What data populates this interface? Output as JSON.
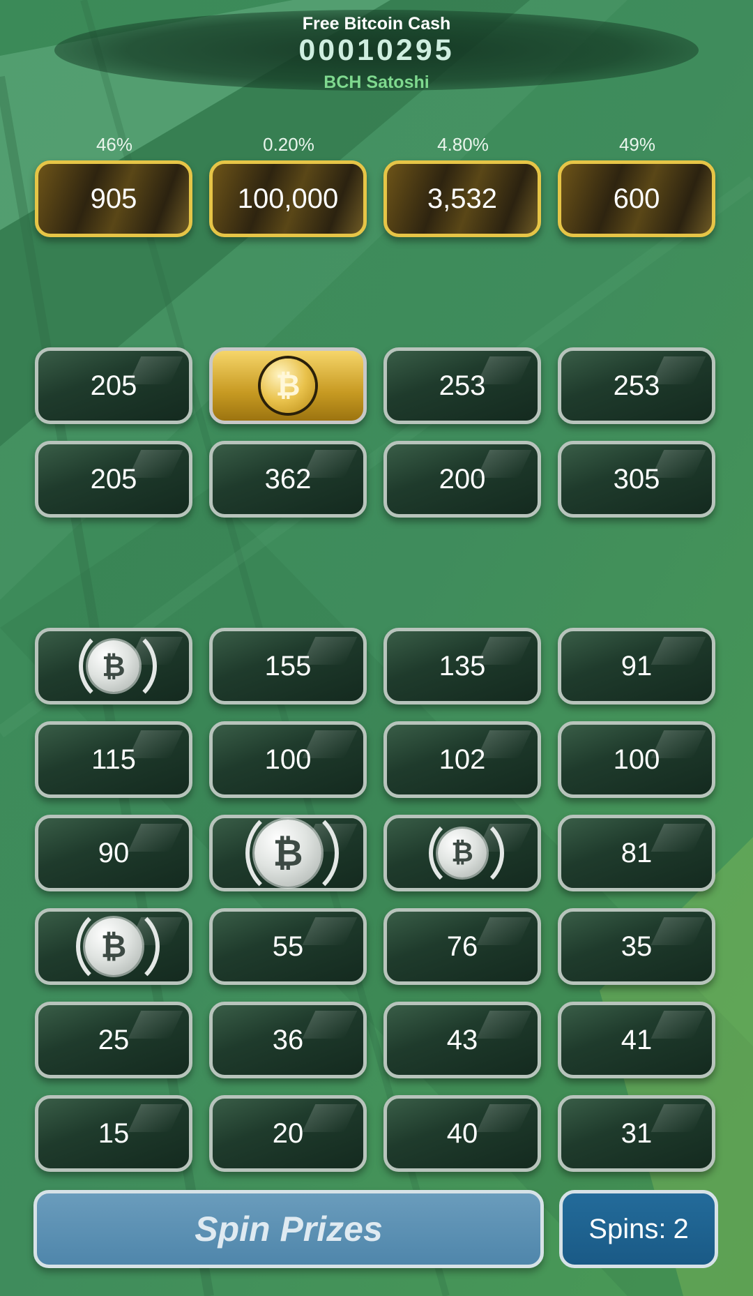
{
  "header": {
    "title": "Free Bitcoin Cash",
    "balance": "00010295",
    "unit": "BCH Satoshi"
  },
  "top_prizes": [
    {
      "percent": "46%",
      "value": "905"
    },
    {
      "percent": "0.20%",
      "value": "100,000"
    },
    {
      "percent": "4.80%",
      "value": "3,532"
    },
    {
      "percent": "49%",
      "value": "600"
    }
  ],
  "middle_rows": [
    [
      "205",
      "BCH coin",
      "253",
      "253"
    ],
    [
      "205",
      "362",
      "200",
      "305"
    ]
  ],
  "bottom_rows": [
    [
      "BCH coin",
      "155",
      "135",
      "91"
    ],
    [
      "115",
      "100",
      "102",
      "100"
    ],
    [
      "90",
      "BCH coin",
      "BCH coin",
      "81"
    ],
    [
      "BCH coin",
      "55",
      "76",
      "35"
    ],
    [
      "25",
      "36",
      "43",
      "41"
    ],
    [
      "15",
      "20",
      "40",
      "31"
    ]
  ],
  "coin_symbol": "₿",
  "coin_icon": "bitcoin-cash-coin-icon",
  "spin_button": "Spin Prizes",
  "spins": {
    "label": "Spins:",
    "count": "2"
  },
  "colors": {
    "background": "#3e8a5a",
    "gold_border": "#e6c547",
    "tile_border": "#b8c4bc",
    "spin_button": "#5a8fb3",
    "spins_badge": "#1f6290"
  }
}
